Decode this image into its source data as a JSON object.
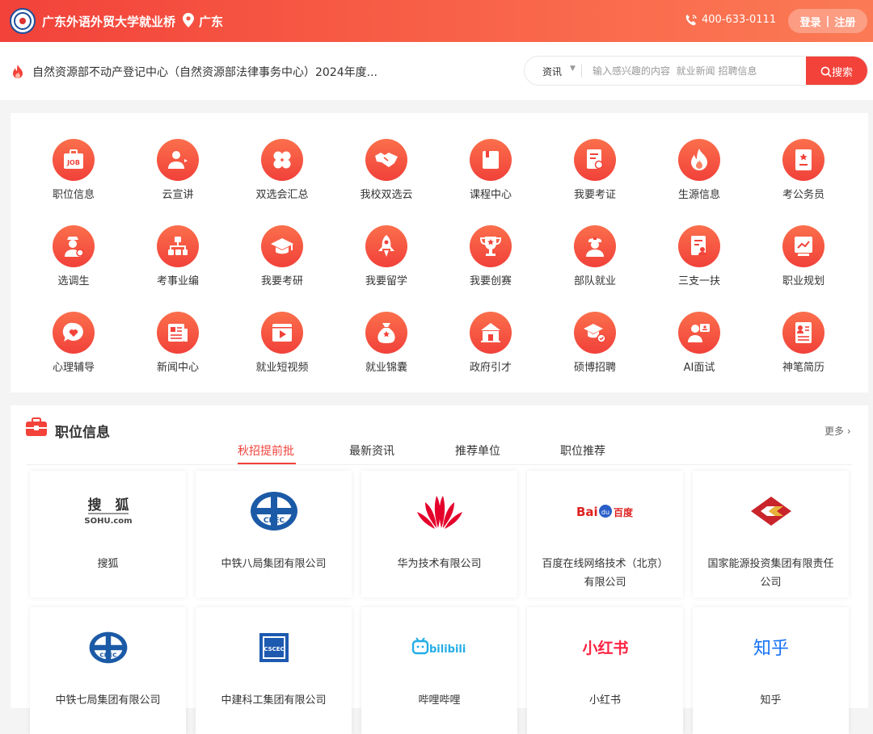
{
  "header": {
    "site_title": "广东外语外贸大学就业桥",
    "location": "广东",
    "phone": "400-633-0111",
    "login": "登录",
    "separator": "|",
    "register": "注册",
    "brand_color": "#f2423a"
  },
  "news": {
    "headline": "自然资源部不动产登记中心（自然资源部法律事务中心）2024年度..."
  },
  "search": {
    "category": "资讯",
    "placeholder": "输入感兴趣的内容  就业新闻 招聘信息",
    "button_label": "搜索"
  },
  "menu": {
    "items": [
      {
        "label": "职位信息",
        "icon": "job-icon"
      },
      {
        "label": "云宣讲",
        "icon": "presenter-icon"
      },
      {
        "label": "双选会汇总",
        "icon": "clover-icon"
      },
      {
        "label": "我校双选云",
        "icon": "handshake-icon"
      },
      {
        "label": "课程中心",
        "icon": "book-icon"
      },
      {
        "label": "我要考证",
        "icon": "certificate-icon"
      },
      {
        "label": "生源信息",
        "icon": "flame-icon"
      },
      {
        "label": "考公务员",
        "icon": "badge-doc-icon"
      },
      {
        "label": "选调生",
        "icon": "official-icon"
      },
      {
        "label": "考事业编",
        "icon": "org-chart-icon"
      },
      {
        "label": "我要考研",
        "icon": "graduation-cap-icon"
      },
      {
        "label": "我要留学",
        "icon": "rocket-icon"
      },
      {
        "label": "我要创赛",
        "icon": "trophy-icon"
      },
      {
        "label": "部队就业",
        "icon": "soldier-icon"
      },
      {
        "label": "三支一扶",
        "icon": "person-doc-icon"
      },
      {
        "label": "职业规划",
        "icon": "chart-board-icon"
      },
      {
        "label": "心理辅导",
        "icon": "heart-bubble-icon"
      },
      {
        "label": "新闻中心",
        "icon": "newspaper-icon"
      },
      {
        "label": "就业短视频",
        "icon": "video-icon"
      },
      {
        "label": "就业锦囊",
        "icon": "money-bag-icon"
      },
      {
        "label": "政府引才",
        "icon": "government-icon"
      },
      {
        "label": "硕博招聘",
        "icon": "scholar-icon"
      },
      {
        "label": "AI面试",
        "icon": "ai-interview-icon"
      },
      {
        "label": "神笔简历",
        "icon": "resume-icon"
      }
    ]
  },
  "jobs": {
    "title": "职位信息",
    "more": "更多",
    "tabs": [
      "秋招提前批",
      "最新资讯",
      "推荐单位",
      "职位推荐"
    ],
    "active_tab": 0,
    "companies": [
      {
        "name": "搜狐",
        "logo": "sohu-logo",
        "logo_text_top": "搜　狐",
        "logo_text_bottom": "SOHU.com"
      },
      {
        "name": "中铁八局集团有限公司",
        "logo": "crec-logo",
        "logo_text_top": "CREC"
      },
      {
        "name": "华为技术有限公司",
        "logo": "huawei-logo"
      },
      {
        "name": "百度在线网络技术（北京）有限公司",
        "logo": "baidu-logo",
        "logo_text_top": "Bai",
        "logo_text_bottom": "百度"
      },
      {
        "name": "国家能源投资集团有限责任公司",
        "logo": "chn-energy-logo"
      },
      {
        "name": "中铁七局集团有限公司",
        "logo": "crec-logo",
        "logo_text_top": "CREC"
      },
      {
        "name": "中建科工集团有限公司",
        "logo": "cscec-logo",
        "logo_text_top": "CSCEC"
      },
      {
        "name": "哔哩哔哩",
        "logo": "bilibili-logo",
        "logo_text_top": "bilibili"
      },
      {
        "name": "小红书",
        "logo": "xiaohongshu-logo",
        "logo_text_top": "小红书"
      },
      {
        "name": "知乎",
        "logo": "zhihu-logo",
        "logo_text_top": "知乎"
      }
    ]
  }
}
